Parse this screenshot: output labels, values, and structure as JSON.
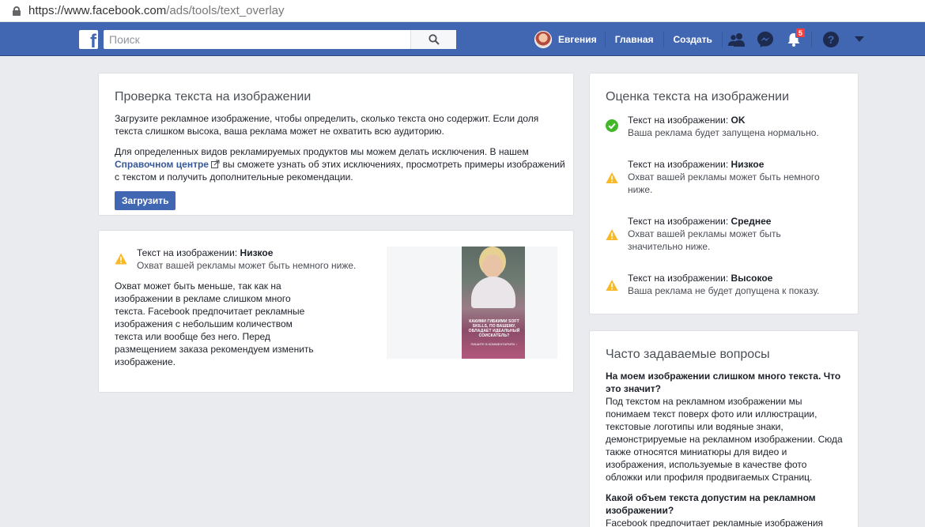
{
  "browser": {
    "url_host": "https://www.facebook.com",
    "url_path": "/ads/tools/text_overlay"
  },
  "header": {
    "logo": "f",
    "search_placeholder": "Поиск",
    "user_name": "Евгения",
    "home": "Главная",
    "create": "Создать",
    "notifications_count": "5",
    "help": "?"
  },
  "check": {
    "title": "Проверка текста на изображении",
    "para1": "Загрузите рекламное изображение, чтобы определить, сколько текста оно содержит. Если доля текста слишком высока, ваша реклама может не охватить всю аудиторию.",
    "para2_before": "Для определенных видов рекламируемых продуктов мы можем делать исключения. В нашем",
    "para2_link": "Справочном центре",
    "para2_after": "вы сможете узнать об этих исключениях, просмотреть примеры изображений с текстом и получить дополнительные рекомендации.",
    "upload_button": "Загрузить"
  },
  "result": {
    "label": "Текст на изображении: ",
    "level": "Низкое",
    "subtitle": "Охват вашей рекламы может быть немного ниже.",
    "description": "Охват может быть меньше, так как на изображении в рекламе слишком много текста. Facebook предпочитает рекламные изображения с небольшим количеством текста или вообще без него. Перед размещением заказа рекомендуем изменить изображение.",
    "image_caption": "КАКИМИ ГИБКИМИ SOFT SKILLS, ПО ВАШЕМУ, ОБЛАДАЕТ ИДЕАЛЬНЫЙ СОИСКАТЕЛЬ?",
    "image_caption_small": "ПИШИТЕ В КОММЕНТАРИЯХ ↓"
  },
  "ratings": {
    "title": "Оценка текста на изображении",
    "items": [
      {
        "label": "Текст на изображении: ",
        "level": "OK",
        "desc": "Ваша реклама будет запущена нормально.",
        "status": "ok",
        "color": "#42b72a"
      },
      {
        "label": "Текст на изображении: ",
        "level": "Низкое",
        "desc": "Охват вашей рекламы может быть немного ниже.",
        "status": "warning",
        "color": "#f7b928"
      },
      {
        "label": "Текст на изображении: ",
        "level": "Среднее",
        "desc": "Охват вашей рекламы может быть значительно ниже.",
        "status": "warning",
        "color": "#f7b928"
      },
      {
        "label": "Текст на изображении: ",
        "level": "Высокое",
        "desc": "Ваша реклама не будет допущена к показу.",
        "status": "warning",
        "color": "#f7b928"
      }
    ]
  },
  "faq": {
    "title": "Часто задаваемые вопросы",
    "q1": "На моем изображении слишком много текста. Что это значит?",
    "a1": "Под текстом на рекламном изображении мы понимаем текст поверх фото или иллюстрации, текстовые логотипы или водяные знаки, демонстрируемые на рекламном изображении. Сюда также относятся миниатюры для видео и изображения, используемые в качестве фото обложки или профиля продвигаемых Страниц.",
    "q2": "Какой объем текста допустим на рекламном изображении?",
    "a2": "Facebook предпочитает рекламные изображения"
  }
}
